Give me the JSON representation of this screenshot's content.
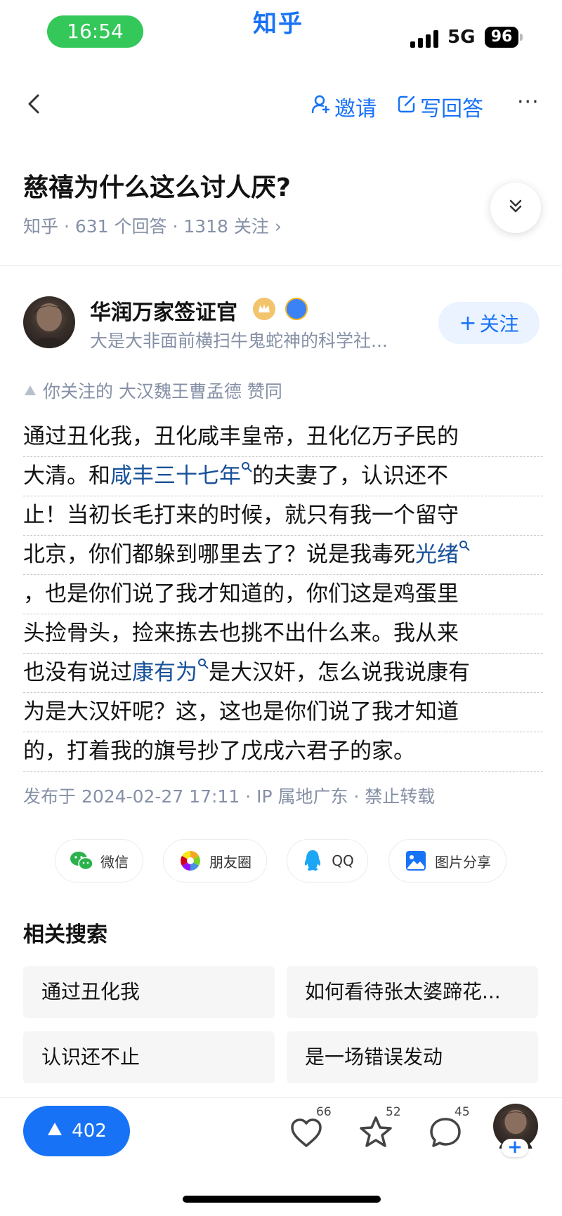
{
  "status_bar": {
    "time": "16:54",
    "network": "5G",
    "battery": "96"
  },
  "app": {
    "brand": "知乎"
  },
  "nav": {
    "invite_label": "邀请",
    "write_answer_label": "写回答",
    "more_label": "···"
  },
  "question": {
    "title": "慈禧为什么这么讨人厌?",
    "meta": "知乎 · 631 个回答 · 1318 关注 ›"
  },
  "author": {
    "name": "华润万家签证官",
    "bio": "大是大非面前横扫牛鬼蛇神的科学社...",
    "follow_label": "关注"
  },
  "upvoted_by": {
    "text": "你关注的 大汉魏王曹孟德 赞同"
  },
  "answer": {
    "lines": [
      {
        "segments": [
          {
            "text": "通过丑化我，丑化咸丰皇帝，丑化亿万子民的",
            "link": false
          }
        ]
      },
      {
        "segments": [
          {
            "text": "大清。和",
            "link": false
          },
          {
            "text": "咸丰三十七年",
            "link": true
          },
          {
            "text": "的夫妻了，认识还不",
            "link": false
          }
        ]
      },
      {
        "segments": [
          {
            "text": "止！当初长毛打来的时候，就只有我一个留守",
            "link": false
          }
        ]
      },
      {
        "segments": [
          {
            "text": "北京，你们都躲到哪里去了？说是我毒死",
            "link": false
          },
          {
            "text": "光绪",
            "link": true
          }
        ]
      },
      {
        "segments": [
          {
            "text": "，也是你们说了我才知道的，你们这是鸡蛋里",
            "link": false
          }
        ]
      },
      {
        "segments": [
          {
            "text": "头捡骨头，捡来拣去也挑不出什么来。我从来",
            "link": false
          }
        ]
      },
      {
        "segments": [
          {
            "text": "也没有说过",
            "link": false
          },
          {
            "text": "康有为",
            "link": true
          },
          {
            "text": "是大汉奸，怎么说我说康有",
            "link": false
          }
        ]
      },
      {
        "segments": [
          {
            "text": "为是大汉奸呢？这，这也是你们说了我才知道",
            "link": false
          }
        ]
      },
      {
        "segments": [
          {
            "text": "的，打着我的旗号抄了戊戌六君子的家。",
            "link": false
          }
        ]
      }
    ],
    "published": "发布于 2024-02-27 17:11 · IP 属地广东 · 禁止转载"
  },
  "share": {
    "wechat": "微信",
    "moments": "朋友圈",
    "qq": "QQ",
    "image_share": "图片分享"
  },
  "related": {
    "title": "相关搜索",
    "items": [
      "通过丑化我",
      "如何看待张太婆蹄花...",
      "认识还不止",
      "是一场错误发动"
    ]
  },
  "bottom_bar": {
    "upvotes": "402",
    "likes": "66",
    "favorites": "52",
    "comments": "45",
    "add_label": "+"
  },
  "colors": {
    "brand_blue": "#1772f6",
    "link_blue": "#175199",
    "meta_gray": "#8590a6",
    "status_green": "#34c759"
  }
}
